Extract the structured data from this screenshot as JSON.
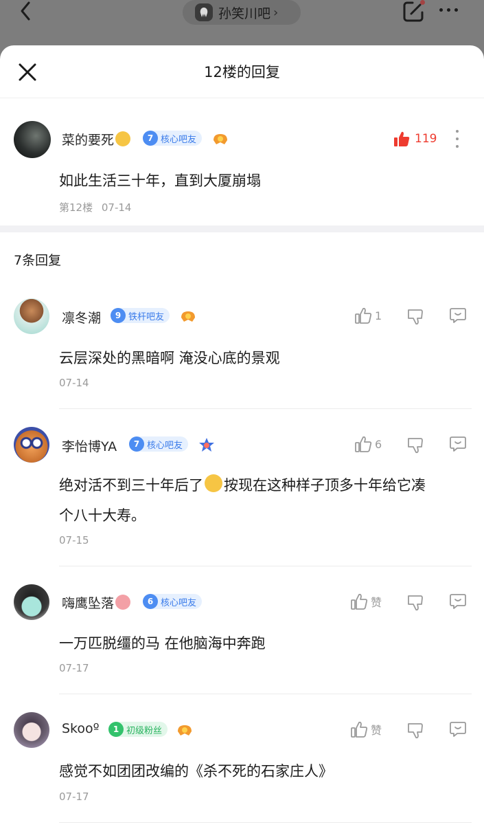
{
  "topbar": {
    "forum_name": "孙笑川吧",
    "forum_chevron": "›"
  },
  "sheet": {
    "title": "12楼的回复"
  },
  "main_post": {
    "username": "菜的要死",
    "level": "7",
    "badge": "核心吧友",
    "like_count": "119",
    "content": "如此生活三十年，直到大厦崩塌",
    "floor": "第12楼",
    "date": "07-14"
  },
  "replies_header": "7条回复",
  "replies": [
    {
      "username": "凛冬潮",
      "level": "9",
      "badge": "铁杆吧友",
      "like_count": "1",
      "content": "云层深处的黑暗啊 淹没心底的景观",
      "date": "07-14"
    },
    {
      "username": "李怡博YA",
      "level": "7",
      "badge": "核心吧友",
      "like_count": "6",
      "content_line1_a": "绝对活不到三十年后了",
      "content_line1_b": "按现在这种样子顶多十年给它凑",
      "content_line2": "个八十大寿。",
      "date": "07-15"
    },
    {
      "username": "嗨鹰坠落",
      "level": "6",
      "badge": "核心吧友",
      "like_label": "赞",
      "content": "一万匹脱缰的马 在他脑海中奔跑",
      "date": "07-17"
    },
    {
      "username": "Skooº",
      "level": "1",
      "badge": "初级粉丝",
      "like_label": "赞",
      "content": "感觉不如团团改编的《杀不死的石家庄人》",
      "date": "07-17"
    }
  ],
  "colors": {
    "accent_red": "#ee3b2f",
    "badge_blue": "#4d8df2",
    "badge_green": "#33c26c",
    "meta_gray": "#9a9a9a"
  }
}
